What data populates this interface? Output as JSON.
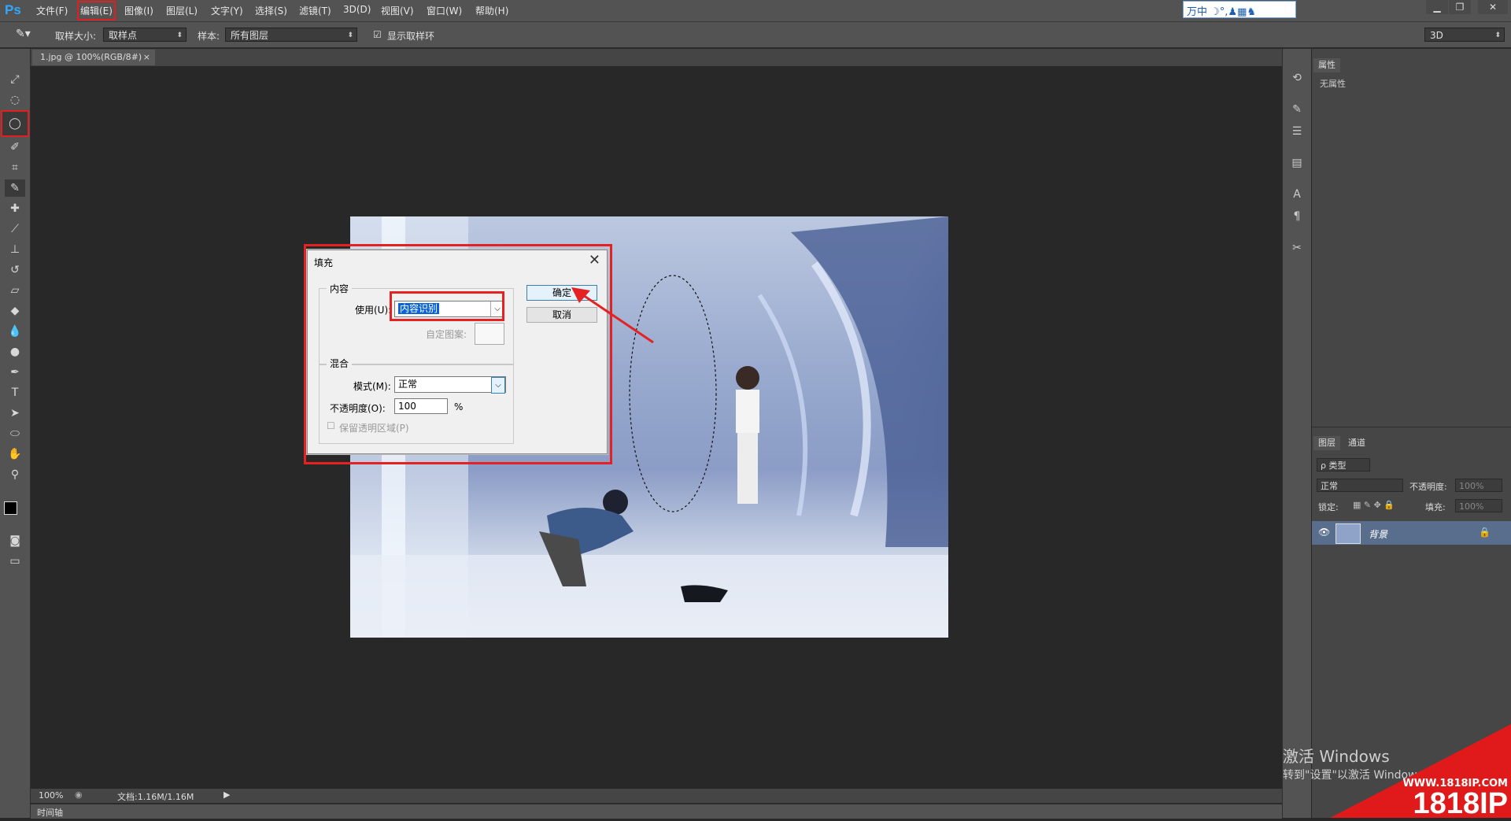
{
  "app": {
    "logo": "Ps"
  },
  "menu": [
    "文件(F)",
    "编辑(E)",
    "图像(I)",
    "图层(L)",
    "文字(Y)",
    "选择(S)",
    "滤镜(T)",
    "3D(D)",
    "视图(V)",
    "窗口(W)",
    "帮助(H)"
  ],
  "ime": {
    "text": "万中 ☽°,♟▦♞"
  },
  "options": {
    "sample_size_label": "取样大小:",
    "sample_size_value": "取样点",
    "sample_label": "样本:",
    "sample_value": "所有图层",
    "show_ring_label": "显示取样环",
    "workspace": "3D"
  },
  "document": {
    "tab_title": "1.jpg @ 100%(RGB/8#)",
    "tab_close": "×"
  },
  "status": {
    "zoom": "100%",
    "doc_info": "文档:1.16M/1.16M",
    "timeline": "时间轴"
  },
  "properties_panel": {
    "tab": "属性",
    "content": "无属性"
  },
  "layers_panel": {
    "tabs": [
      "图层",
      "通道"
    ],
    "filter_kind": "ρ 类型",
    "blend_mode": "正常",
    "opacity_label": "不透明度:",
    "opacity_value": "100%",
    "lock_label": "锁定:",
    "fill_label": "填充:",
    "fill_value": "100%",
    "layer_name": "背景"
  },
  "dialog": {
    "title": "填充",
    "contents_group": "内容",
    "use_label": "使用(U):",
    "use_value": "内容识别",
    "custom_pattern_label": "自定图案:",
    "blending_group": "混合",
    "mode_label": "模式(M):",
    "mode_value": "正常",
    "opacity_label": "不透明度(O):",
    "opacity_value": "100",
    "percent": "%",
    "preserve_label": "保留透明区域(P)",
    "ok": "确定",
    "cancel": "取消"
  },
  "watermark": {
    "line1": "激活 Windows",
    "line2": "转到\"设置\"以激活 Windows。",
    "site": "WWW.1818IP.COM",
    "brand": "1818IP"
  },
  "colors": {
    "accent_red": "#e52222",
    "selection_blue": "#0a64d8"
  }
}
